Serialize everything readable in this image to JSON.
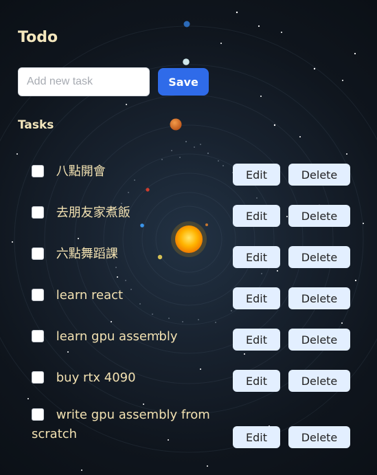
{
  "app": {
    "title": "Todo"
  },
  "form": {
    "placeholder": "Add new task",
    "value": "",
    "save_label": "Save"
  },
  "tasks_section": {
    "title": "Tasks"
  },
  "actions": {
    "edit_label": "Edit",
    "delete_label": "Delete"
  },
  "tasks": [
    {
      "text": "八點開會",
      "checked": false
    },
    {
      "text": "去朋友家煮飯",
      "checked": false
    },
    {
      "text": "六點舞蹈課",
      "checked": false
    },
    {
      "text": "learn react",
      "checked": false
    },
    {
      "text": "learn gpu assembly",
      "checked": false
    },
    {
      "text": "buy rtx 4090",
      "checked": false
    },
    {
      "text": "write gpu assembly from scratch",
      "checked": false
    }
  ],
  "theme": {
    "title_color": "#f4e7bd",
    "task_text_color": "#f3e2b2",
    "primary_button_color": "#2f6be9",
    "secondary_button_color": "#e3efff",
    "background_color": "#11161d"
  }
}
